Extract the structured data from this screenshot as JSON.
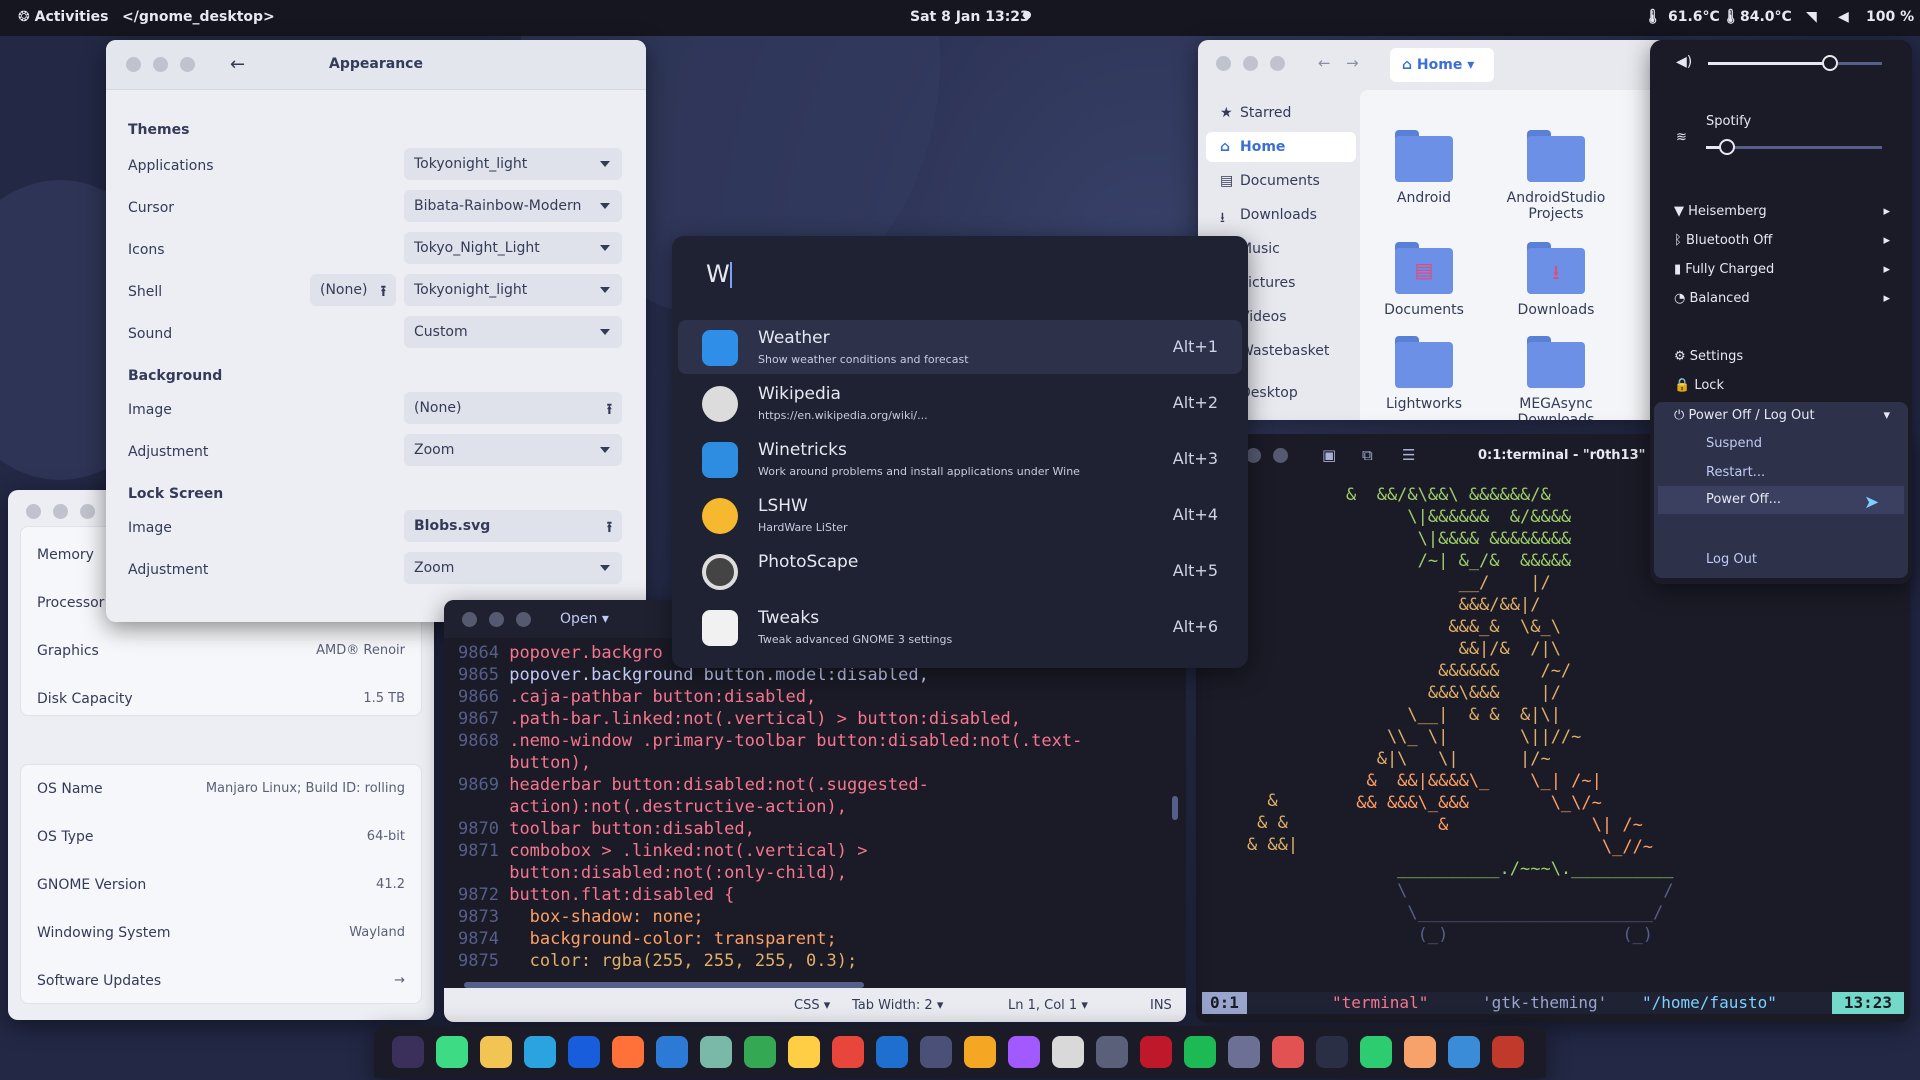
{
  "topbar": {
    "activities": "Activities",
    "app": "</gnome_desktop>",
    "datetime": "Sat 8 Jan  13:23",
    "cpu_temp": "61.6°C",
    "gpu_temp": "84.0°C",
    "battery": "100 %"
  },
  "appearance": {
    "title": "Appearance",
    "themes_heading": "Themes",
    "rows": [
      {
        "label": "Applications",
        "value": "Tokyonight_light"
      },
      {
        "label": "Cursor",
        "value": "Bibata-Rainbow-Modern"
      },
      {
        "label": "Icons",
        "value": "Tokyo_Night_Light"
      },
      {
        "label": "Shell",
        "value": "Tokyonight_light",
        "extra": "(None)"
      },
      {
        "label": "Sound",
        "value": "Custom"
      }
    ],
    "background_heading": "Background",
    "bg_image_label": "Image",
    "bg_image_value": "(None)",
    "bg_adj_label": "Adjustment",
    "bg_adj_value": "Zoom",
    "lock_heading": "Lock Screen",
    "lock_image_label": "Image",
    "lock_image_value": "Blobs.svg",
    "lock_adj_label": "Adjustment",
    "lock_adj_value": "Zoom"
  },
  "about": {
    "hw": [
      {
        "label": "Memory",
        "value": ""
      },
      {
        "label": "Processor",
        "value": ""
      },
      {
        "label": "Graphics",
        "value": "AMD® Renoir"
      },
      {
        "label": "Disk Capacity",
        "value": "1.5 TB"
      }
    ],
    "sw": [
      {
        "label": "OS Name",
        "value": "Manjaro Linux; Build ID: rolling"
      },
      {
        "label": "OS Type",
        "value": "64-bit"
      },
      {
        "label": "GNOME Version",
        "value": "41.2"
      },
      {
        "label": "Windowing System",
        "value": "Wayland"
      },
      {
        "label": "Software Updates",
        "value": ""
      }
    ]
  },
  "files": {
    "location": "Home",
    "sidebar": [
      "Starred",
      "Home",
      "Documents",
      "Downloads",
      "Music",
      "Pictures",
      "Videos",
      "Wastebasket",
      "Desktop"
    ],
    "folders": [
      "Android",
      "AndroidStudio Projects",
      "Documents",
      "Downloads",
      "Lightworks",
      "MEGAsync Downloads"
    ]
  },
  "launcher": {
    "query": "W",
    "results": [
      {
        "title": "Weather",
        "desc": "Show weather conditions and forecast",
        "key": "Alt+1",
        "color": "#2f8fe8"
      },
      {
        "title": "Wikipedia",
        "desc": "https://en.wikipedia.org/wiki/...",
        "key": "Alt+2",
        "color": "#dcdcdc"
      },
      {
        "title": "Winetricks",
        "desc": "Work around problems and install applications under Wine",
        "key": "Alt+3",
        "color": "#2e8de0"
      },
      {
        "title": "LSHW",
        "desc": "HardWare LiSter",
        "key": "Alt+4",
        "color": "#f5b82e"
      },
      {
        "title": "PhotoScape",
        "desc": "",
        "key": "Alt+5",
        "color": "#444444"
      },
      {
        "title": "Tweaks",
        "desc": "Tweak advanced GNOME 3 settings",
        "key": "Alt+6",
        "color": "#f1f1f1"
      }
    ]
  },
  "editor": {
    "tab": "Open",
    "lines": [
      {
        "n": "9864",
        "code": "popover.backgro"
      },
      {
        "n": "9865",
        "code": "popover.background button.model:disabled,"
      },
      {
        "n": "9866",
        "code": ".caja-pathbar button:disabled,"
      },
      {
        "n": "9867",
        "code": ".path-bar.linked:not(.vertical) > button:disabled,"
      },
      {
        "n": "9868",
        "code": ".nemo-window .primary-toolbar button:disabled:not(.text-"
      },
      {
        "n": "",
        "code": "button),"
      },
      {
        "n": "9869",
        "code": "headerbar button:disabled:not(.suggested-"
      },
      {
        "n": "",
        "code": "action):not(.destructive-action),"
      },
      {
        "n": "9870",
        "code": "toolbar button:disabled,"
      },
      {
        "n": "9871",
        "code": "combobox > .linked:not(.vertical) >"
      },
      {
        "n": "",
        "code": "button:disabled:not(:only-child),"
      },
      {
        "n": "9872",
        "code": "button.flat:disabled {"
      },
      {
        "n": "9873",
        "code": "  box-shadow: none;"
      },
      {
        "n": "9874",
        "code": "  background-color: transparent;"
      },
      {
        "n": "9875",
        "code": "  color: rgba(255, 255, 255, 0.3);"
      }
    ],
    "status": {
      "lang": "CSS",
      "tab_width": "Tab Width: 2",
      "pos": "Ln 1, Col 1",
      "mode": "INS"
    }
  },
  "terminal": {
    "title": "0:1:terminal - \"r0th13\"  1",
    "status": {
      "win": "0:",
      "pane": "1",
      "name": "\"terminal\"",
      "branch": "'gtk-theming'",
      "path": "\"/home/fausto\"",
      "time": "13:23"
    }
  },
  "quick": {
    "media": "Spotify",
    "items": [
      {
        "label": "Heisemberg"
      },
      {
        "label": "Bluetooth Off"
      },
      {
        "label": "Fully Charged"
      },
      {
        "label": "Balanced"
      }
    ],
    "settings": "Settings",
    "lock": "Lock",
    "power": "Power Off / Log Out",
    "submenu": [
      "Suspend",
      "Restart...",
      "Power Off..."
    ],
    "logout": "Log Out",
    "volume": 0.7,
    "brightness": 0.12
  },
  "dock": {
    "apps": [
      "obs-icon",
      "android-studio-icon",
      "files-icon",
      "telegram-icon",
      "bitwarden-icon",
      "firefox-icon",
      "vscode-icon",
      "krita-icon",
      "maps-icon",
      "text-editor-icon",
      "chrome-icon",
      "virtualbox-icon",
      "terminal-window-icon",
      "photos-icon",
      "figma-icon",
      "inkscape-icon",
      "gear-extension-icon",
      "sound-icon",
      "spotify-icon",
      "screenshot-icon",
      "audio-icon",
      "terminal-icon",
      "extensions-icon",
      "tweaks-icon",
      "settings-icon",
      "trash-icon"
    ]
  }
}
